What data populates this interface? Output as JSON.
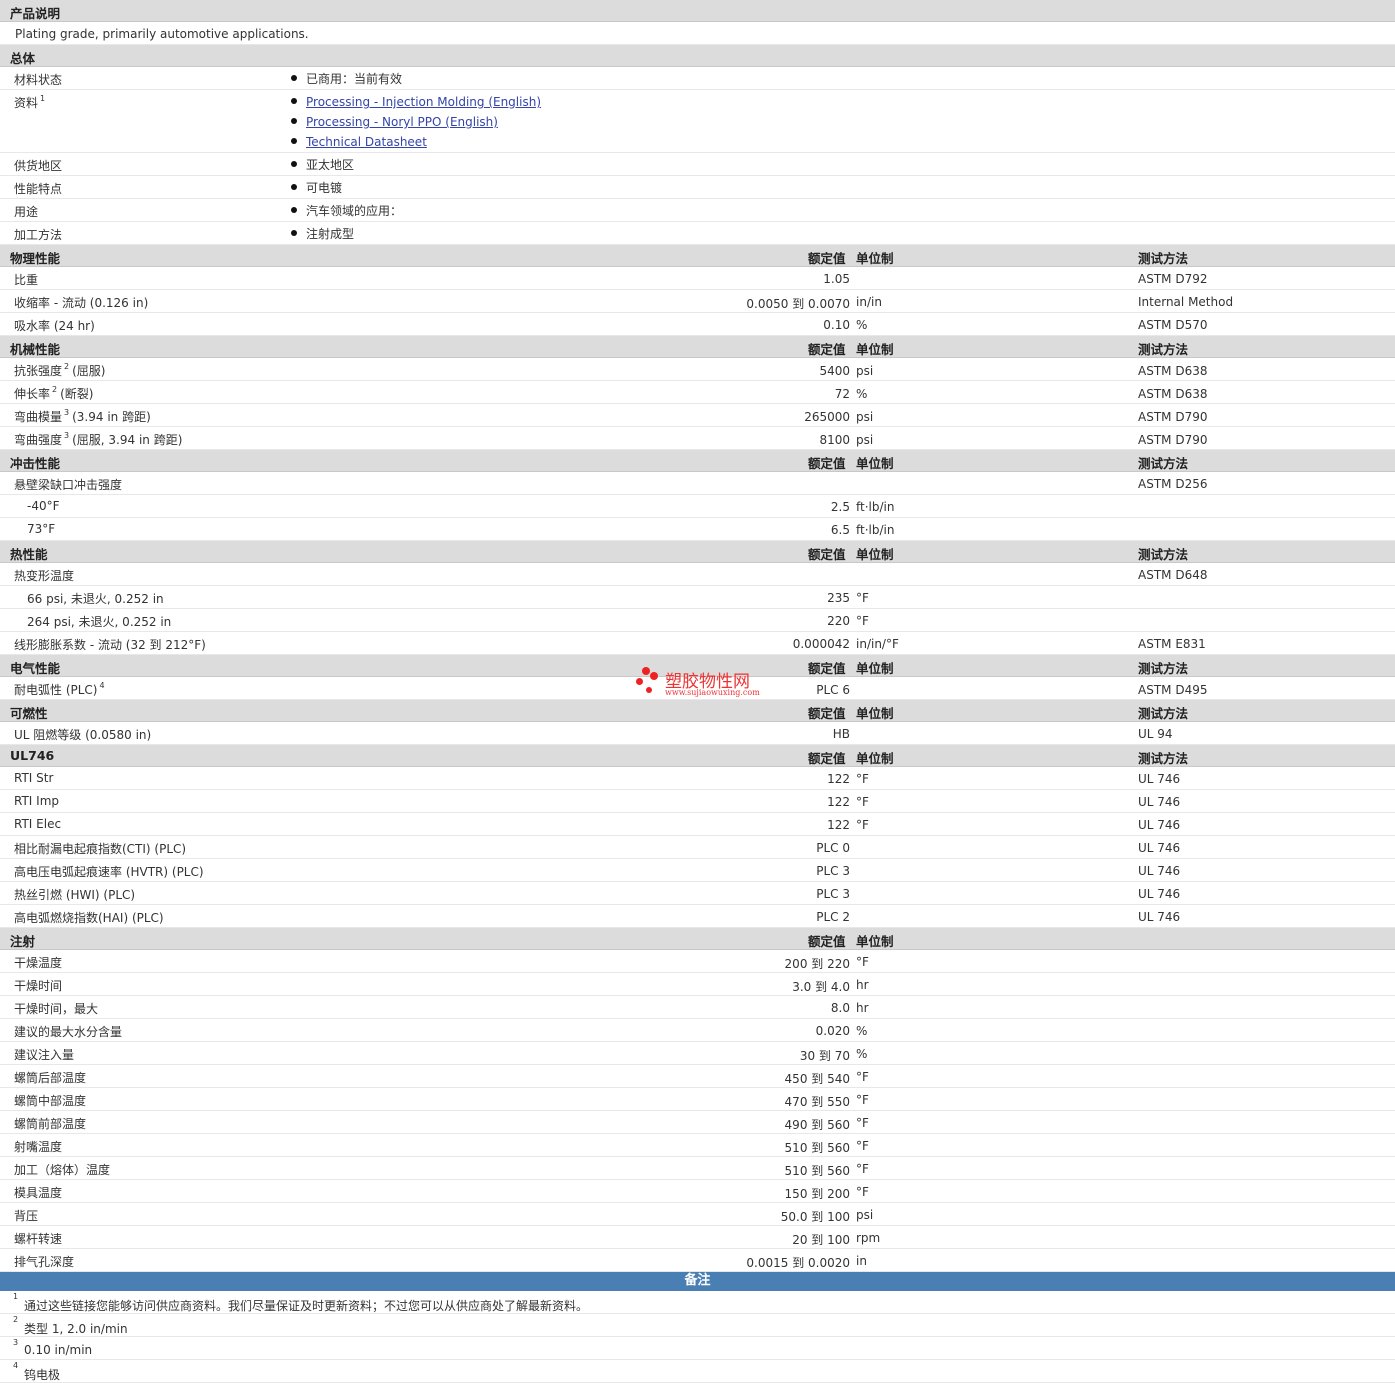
{
  "description": {
    "title": "产品说明",
    "text": "Plating grade, primarily automotive applications."
  },
  "general": {
    "title": "总体",
    "rows": [
      {
        "label": "材料状态",
        "sup": "",
        "items": [
          "已商用：当前有效"
        ],
        "links": false
      },
      {
        "label": "资料",
        "sup": "1",
        "items": [
          "Processing - Injection Molding (English)",
          "Processing - Noryl PPO (English)",
          "Technical Datasheet"
        ],
        "links": true
      },
      {
        "label": "供货地区",
        "sup": "",
        "items": [
          "亚太地区"
        ],
        "links": false
      },
      {
        "label": "性能特点",
        "sup": "",
        "items": [
          "可电镀"
        ],
        "links": false
      },
      {
        "label": "用途",
        "sup": "",
        "items": [
          "汽车领域的应用："
        ],
        "links": false
      },
      {
        "label": "加工方法",
        "sup": "",
        "items": [
          "注射成型"
        ],
        "links": false
      }
    ]
  },
  "headers": {
    "value": "额定值",
    "unit": "单位制",
    "test": "测试方法"
  },
  "sections": [
    {
      "title": "物理性能",
      "show_test": true,
      "rows": [
        {
          "label": "比重",
          "value": "1.05",
          "unit": "",
          "test": "ASTM D792"
        },
        {
          "label": "收缩率 - 流动 (0.126 in)",
          "value": "0.0050 到 0.0070",
          "unit": "in/in",
          "test": "Internal Method"
        },
        {
          "label": "吸水率 (24 hr)",
          "value": "0.10",
          "unit": "%",
          "test": "ASTM D570"
        }
      ]
    },
    {
      "title": "机械性能",
      "show_test": true,
      "rows": [
        {
          "label": "抗张强度",
          "sup": "2",
          "label2": "(屈服)",
          "value": "5400",
          "unit": "psi",
          "test": "ASTM D638"
        },
        {
          "label": "伸长率",
          "sup": "2",
          "label2": "(断裂)",
          "value": "72",
          "unit": "%",
          "test": "ASTM D638"
        },
        {
          "label": "弯曲模量",
          "sup": "3",
          "label2": "(3.94 in 跨距)",
          "value": "265000",
          "unit": "psi",
          "test": "ASTM D790"
        },
        {
          "label": "弯曲强度",
          "sup": "3",
          "label2": "(屈服, 3.94 in 跨距)",
          "value": "8100",
          "unit": "psi",
          "test": "ASTM D790"
        }
      ]
    },
    {
      "title": "冲击性能",
      "show_test": true,
      "rows": [
        {
          "label": "悬壁梁缺口冲击强度",
          "value": "",
          "unit": "",
          "test": "ASTM D256"
        },
        {
          "label": "-40°F",
          "indent": true,
          "value": "2.5",
          "unit": "ft·lb/in",
          "test": ""
        },
        {
          "label": "73°F",
          "indent": true,
          "value": "6.5",
          "unit": "ft·lb/in",
          "test": ""
        }
      ]
    },
    {
      "title": "热性能",
      "show_test": true,
      "rows": [
        {
          "label": "热变形温度",
          "value": "",
          "unit": "",
          "test": "ASTM D648"
        },
        {
          "label": "66 psi, 未退火, 0.252 in",
          "indent": true,
          "value": "235",
          "unit": "°F",
          "test": ""
        },
        {
          "label": "264 psi, 未退火, 0.252 in",
          "indent": true,
          "value": "220",
          "unit": "°F",
          "test": ""
        },
        {
          "label": "线形膨胀系数 - 流动 (32 到 212°F)",
          "value": "0.000042",
          "unit": "in/in/°F",
          "test": "ASTM E831"
        }
      ]
    },
    {
      "title": "电气性能",
      "show_test": true,
      "rows": [
        {
          "label": "耐电弧性 (PLC)",
          "sup": "4",
          "value": "PLC 6",
          "unit": "",
          "test": "ASTM D495"
        }
      ]
    },
    {
      "title": "可燃性",
      "show_test": true,
      "rows": [
        {
          "label": "UL 阻燃等级 (0.0580 in)",
          "value": "HB",
          "unit": "",
          "test": "UL 94"
        }
      ]
    },
    {
      "title": "UL746",
      "show_test": true,
      "rows": [
        {
          "label": "RTI Str",
          "value": "122",
          "unit": "°F",
          "test": "UL 746"
        },
        {
          "label": "RTI Imp",
          "value": "122",
          "unit": "°F",
          "test": "UL 746"
        },
        {
          "label": "RTI Elec",
          "value": "122",
          "unit": "°F",
          "test": "UL 746"
        },
        {
          "label": "相比耐漏电起痕指数(CTI) (PLC)",
          "value": "PLC 0",
          "unit": "",
          "test": "UL 746"
        },
        {
          "label": "高电压电弧起痕速率 (HVTR) (PLC)",
          "value": "PLC 3",
          "unit": "",
          "test": "UL 746"
        },
        {
          "label": "热丝引燃 (HWI) (PLC)",
          "value": "PLC 3",
          "unit": "",
          "test": "UL 746"
        },
        {
          "label": "高电弧燃烧指数(HAI) (PLC)",
          "value": "PLC 2",
          "unit": "",
          "test": "UL 746"
        }
      ]
    },
    {
      "title": "注射",
      "show_test": false,
      "rows": [
        {
          "label": "干燥温度",
          "value": "200 到 220",
          "unit": "°F",
          "test": ""
        },
        {
          "label": "干燥时间",
          "value": "3.0 到 4.0",
          "unit": "hr",
          "test": ""
        },
        {
          "label": "干燥时间，最大",
          "value": "8.0",
          "unit": "hr",
          "test": ""
        },
        {
          "label": "建议的最大水分含量",
          "value": "0.020",
          "unit": "%",
          "test": ""
        },
        {
          "label": "建议注入量",
          "value": "30 到 70",
          "unit": "%",
          "test": ""
        },
        {
          "label": "螺筒后部温度",
          "value": "450 到 540",
          "unit": "°F",
          "test": ""
        },
        {
          "label": "螺筒中部温度",
          "value": "470 到 550",
          "unit": "°F",
          "test": ""
        },
        {
          "label": "螺筒前部温度",
          "value": "490 到 560",
          "unit": "°F",
          "test": ""
        },
        {
          "label": "射嘴温度",
          "value": "510 到 560",
          "unit": "°F",
          "test": ""
        },
        {
          "label": "加工（熔体）温度",
          "value": "510 到 560",
          "unit": "°F",
          "test": ""
        },
        {
          "label": "模具温度",
          "value": "150 到 200",
          "unit": "°F",
          "test": ""
        },
        {
          "label": "背压",
          "value": "50.0 到 100",
          "unit": "psi",
          "test": ""
        },
        {
          "label": "螺杆转速",
          "value": "20 到 100",
          "unit": "rpm",
          "test": ""
        },
        {
          "label": "排气孔深度",
          "value": "0.0015 到 0.0020",
          "unit": "in",
          "test": ""
        }
      ]
    }
  ],
  "notes": {
    "title": "备注",
    "items": [
      {
        "num": "1",
        "text": "通过这些链接您能够访问供应商资料。我们尽量保证及时更新资料；不过您可以从供应商处了解最新资料。"
      },
      {
        "num": "2",
        "text": "类型 1, 2.0 in/min"
      },
      {
        "num": "3",
        "text": "0.10 in/min"
      },
      {
        "num": "4",
        "text": "钨电极"
      }
    ]
  },
  "watermark": {
    "name": "塑胶物性网",
    "url": "www.sujiaowuxing.com",
    "color": "#ee2222"
  }
}
